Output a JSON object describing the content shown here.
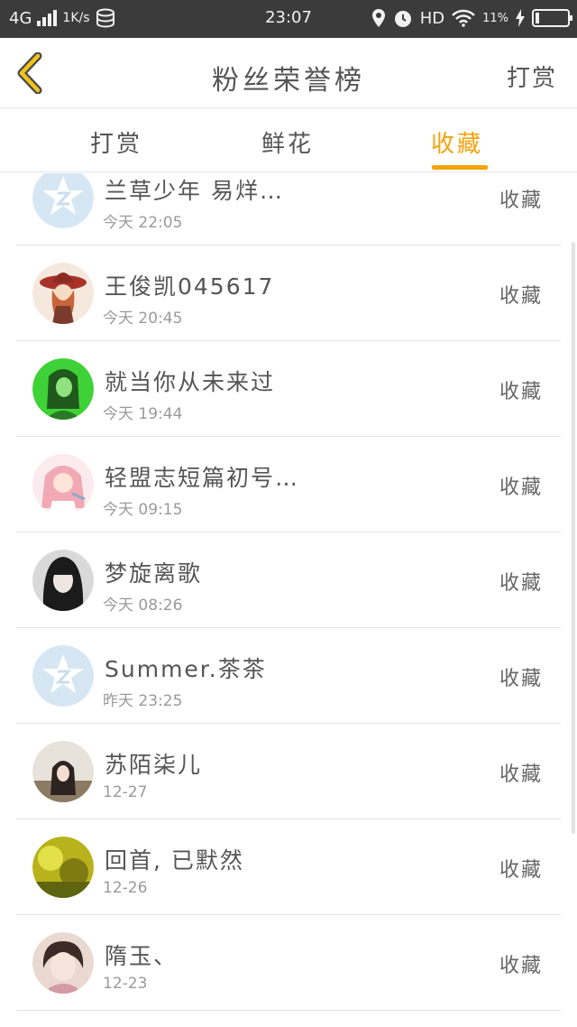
{
  "status_bar": {
    "network": "4G",
    "speed": "1K/s",
    "time": "23:07",
    "hd": "HD",
    "battery_text": "11%",
    "battery_level": 0.11
  },
  "header": {
    "title": "粉丝荣誉榜",
    "right_action": "打赏"
  },
  "tabs": [
    {
      "label": "打赏"
    },
    {
      "label": "鲜花"
    },
    {
      "label": "收藏"
    }
  ],
  "active_tab_color": "#f3a30c",
  "list": [
    {
      "name": "兰草少年 易烊…",
      "time": "今天 22:05",
      "action": "收藏",
      "avatar": "default-qq-avatar"
    },
    {
      "name": "王俊凯045617",
      "time": "今天 20:45",
      "action": "收藏",
      "avatar": "anime-witch-avatar"
    },
    {
      "name": "就当你从未来过",
      "time": "今天 19:44",
      "action": "收藏",
      "avatar": "green-girl-avatar"
    },
    {
      "name": "轻盟志短篇初号…",
      "time": "今天 09:15",
      "action": "收藏",
      "avatar": "anime-girl-avatar"
    },
    {
      "name": "梦旋离歌",
      "time": "今天 08:26",
      "action": "收藏",
      "avatar": "dark-hair-girl-avatar"
    },
    {
      "name": "Summer.茶茶",
      "time": "昨天 23:25",
      "action": "收藏",
      "avatar": "default-qq-avatar"
    },
    {
      "name": "苏陌柒儿",
      "time": "12-27",
      "action": "收藏",
      "avatar": "girl-photo-avatar"
    },
    {
      "name": "回首, 已默然",
      "time": "12-26",
      "action": "收藏",
      "avatar": "yellow-scene-avatar"
    },
    {
      "name": "隋玉、",
      "time": "12-23",
      "action": "收藏",
      "avatar": "baby-girl-avatar"
    }
  ]
}
